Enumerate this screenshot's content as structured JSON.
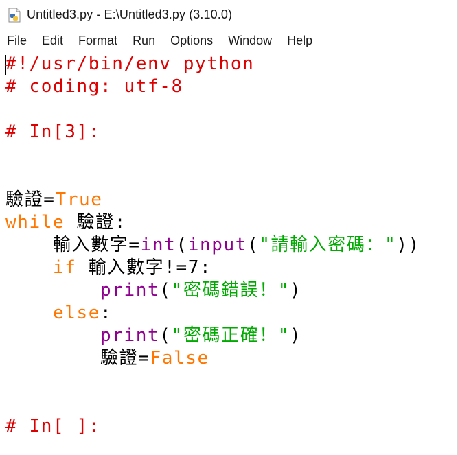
{
  "window": {
    "title": "Untitled3.py - E:\\Untitled3.py (3.10.0)"
  },
  "menu": [
    "File",
    "Edit",
    "Format",
    "Run",
    "Options",
    "Window",
    "Help"
  ],
  "colors": {
    "keyword": "#ff7700",
    "builtin": "#900090",
    "string": "#00aa00",
    "comment": "#dd0000",
    "default": "#000000"
  },
  "code": {
    "l1": {
      "c": "#!/usr/bin/env python"
    },
    "l2": {
      "c": "# coding: utf-8"
    },
    "l4": {
      "c": "# In[3]:"
    },
    "l7": {
      "v": "驗證",
      "op": "=",
      "k": "True"
    },
    "l8": {
      "k": "while",
      "sp": " ",
      "v": "驗證:"
    },
    "l9": {
      "ind": "    ",
      "v": "輸入數字=",
      "b1": "int",
      "p1": "(",
      "b2": "input",
      "p2": "(",
      "s": "\"請輸入密碼：\"",
      "p3": "))"
    },
    "l10": {
      "ind": "    ",
      "k": "if",
      "v": " 輸入數字!=7:"
    },
    "l11": {
      "ind": "        ",
      "b": "print",
      "p1": "(",
      "s": "\"密碼錯誤！\"",
      "p2": ")"
    },
    "l12": {
      "ind": "    ",
      "k": "else",
      "p": ":"
    },
    "l13": {
      "ind": "        ",
      "b": "print",
      "p1": "(",
      "s": "\"密碼正確！\"",
      "p2": ")"
    },
    "l14": {
      "ind": "        ",
      "v": "驗證=",
      "k": "False"
    },
    "l17": {
      "c": "# In[ ]:"
    }
  }
}
